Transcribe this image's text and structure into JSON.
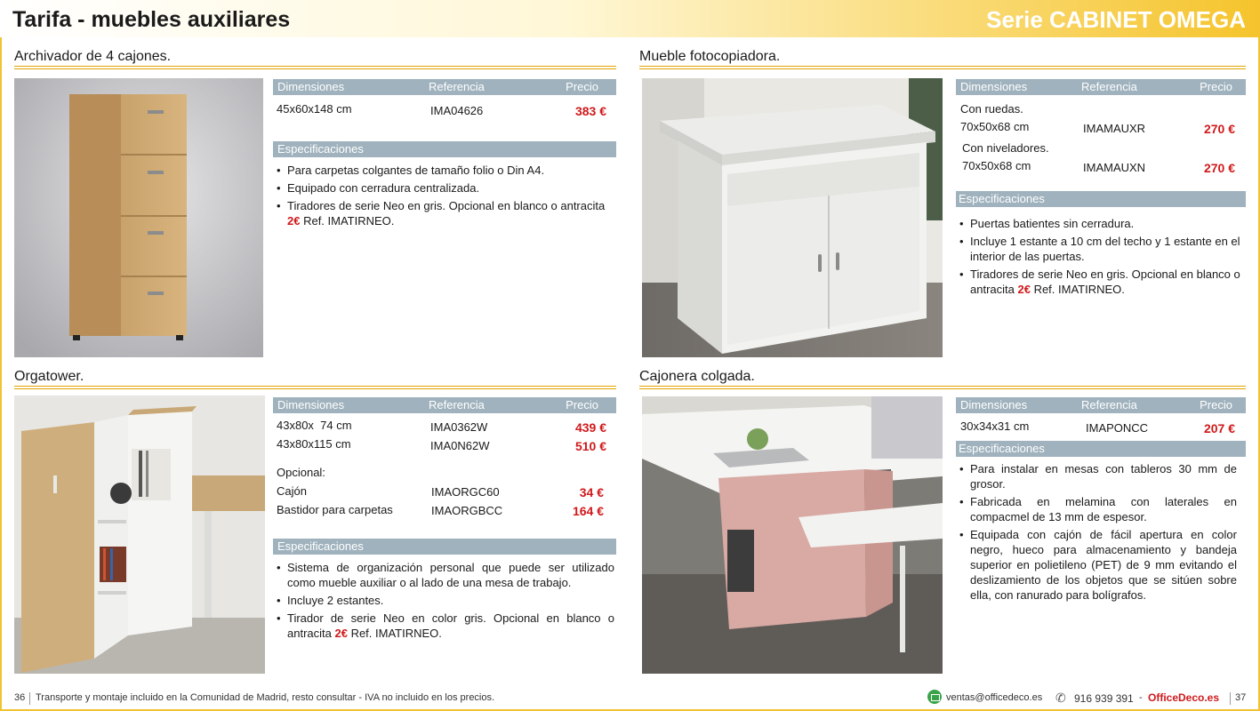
{
  "header": {
    "title": "Tarifa - muebles auxiliares",
    "series": "Serie CABINET OMEGA"
  },
  "columns": {
    "dim": "Dimensiones",
    "ref": "Referencia",
    "price": "Precio",
    "specs": "Especificaciones"
  },
  "archivador": {
    "title": "Archivador de 4 cajones.",
    "rows": [
      {
        "dim": "45x60x148 cm",
        "ref": "IMA04626",
        "price": "383 €"
      }
    ],
    "specs": [
      "Para carpetas colgantes de tamaño folio o Din A4.",
      "Equipado con cerradura centralizada.",
      {
        "pre": "Tiradores de serie Neo en gris. Opcional en blanco o antracita ",
        "hl": "2€",
        "post": " Ref. IMATIRNEO."
      }
    ]
  },
  "fotocopiadora": {
    "title": "Mueble fotocopiadora.",
    "rows": [
      {
        "label": "Con ruedas.",
        "dim": "70x50x68 cm",
        "ref": "IMAMAUXR",
        "price": "270 €"
      },
      {
        "label": "Con niveladores.",
        "dim": "70x50x68 cm",
        "ref": "IMAMAUXN",
        "price": "270 €"
      }
    ],
    "specs": [
      "Puertas batientes sin cerradura.",
      "Incluye 1 estante a 10 cm del techo y 1 estante en el interior de las puertas.",
      {
        "pre": "Tiradores de serie Neo en gris. Opcional en blanco o antracita ",
        "hl": "2€",
        "post": " Ref. IMATIRNEO."
      }
    ]
  },
  "orgatower": {
    "title": "Orgatower.",
    "rows": [
      {
        "dim": "43x80x  74 cm",
        "ref": "IMA0362W",
        "price": "439 €"
      },
      {
        "dim": "43x80x115 cm",
        "ref": "IMA0N62W",
        "price": "510 €"
      }
    ],
    "optional_label": "Opcional:",
    "optional": [
      {
        "dim": "Cajón",
        "ref": "IMAORGC60",
        "price": "34 €"
      },
      {
        "dim": "Bastidor para carpetas",
        "ref": "IMAORGBCC",
        "price": "164 €"
      }
    ],
    "specs": [
      "Sistema de organización personal que puede ser utilizado como mueble auxiliar o al lado de una mesa de trabajo.",
      "Incluye 2 estantes.",
      {
        "pre": "Tirador de serie Neo en color gris. Opcional en blanco o antracita ",
        "hl": "2€",
        "post": " Ref. IMATIRNEO."
      }
    ]
  },
  "cajonera": {
    "title": "Cajonera colgada.",
    "rows": [
      {
        "dim": "30x34x31 cm",
        "ref": "IMAPONCC",
        "price": "207 €"
      }
    ],
    "specs": [
      "Para instalar en mesas con tableros 30 mm de grosor.",
      "Fabricada en melamina con laterales en compacmel de 13 mm de espesor.",
      "Equipada con cajón de fácil apertura en color negro, hueco para almacenamiento y bandeja superior en polietileno (PET) de 9 mm evitando el deslizamiento de los objetos que se sitúen sobre ella, con ranurado para bolígrafos."
    ]
  },
  "footer": {
    "page_left": "36",
    "note": "Transporte y montaje incluido en la Comunidad de Madrid, resto consultar - IVA no incluido en los precios.",
    "email": "ventas@officedeco.es",
    "phone": "916 939 391",
    "dash": "-",
    "brand": "OfficeDeco.es",
    "page_right": "37"
  }
}
